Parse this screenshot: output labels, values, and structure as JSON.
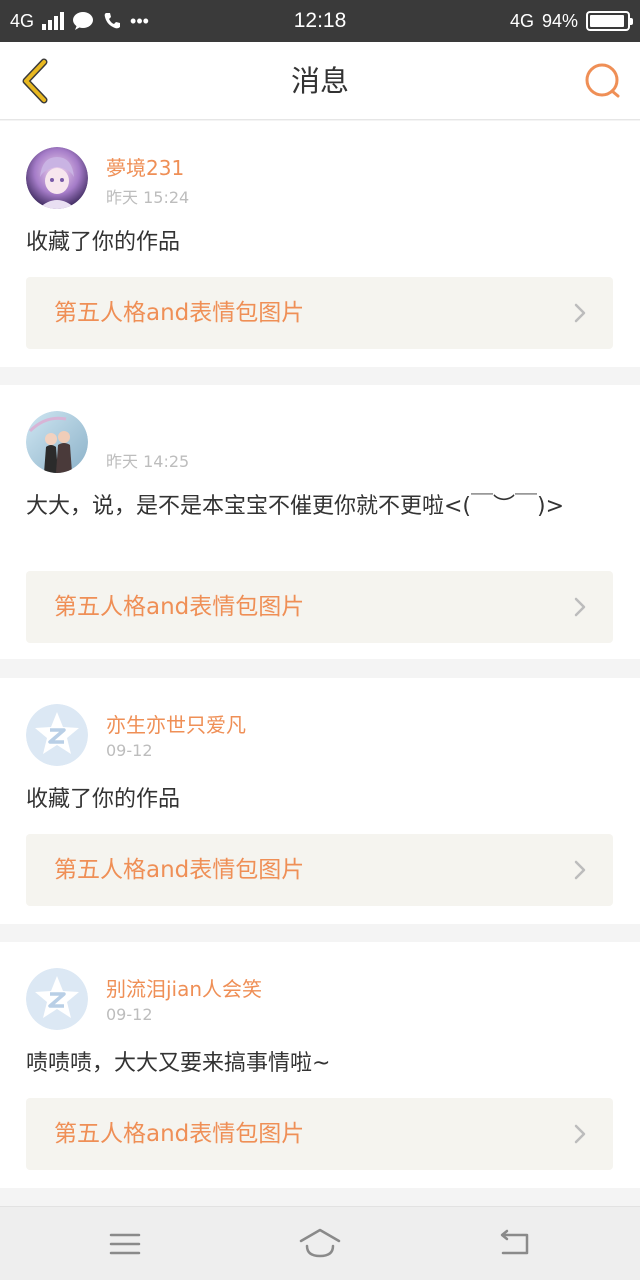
{
  "status_bar": {
    "network": "4G",
    "time": "12:18",
    "data_type": "4G",
    "battery": "94%",
    "battery_level": 0.94,
    "more": "•••"
  },
  "nav": {
    "title": "消息"
  },
  "messages": [
    {
      "username": "夢境231",
      "time": "昨天 15:24",
      "text": "收藏了你的作品",
      "work_title": "第五人格and表情包图片",
      "avatar": "anime-avatar"
    },
    {
      "username": "",
      "time": "昨天 14:25",
      "text": "大大，说，是不是本宝宝不催更你就不更啦<(￣︶￣)>",
      "work_title": "第五人格and表情包图片",
      "avatar": "photo-avatar"
    },
    {
      "username": "亦生亦世只爱凡",
      "time": "09-12",
      "text": "收藏了你的作品",
      "work_title": "第五人格and表情包图片",
      "avatar": "default-avatar"
    },
    {
      "username": "别流泪jian人会笑",
      "time": "09-12",
      "text": "啧啧啧，大大又要来搞事情啦~",
      "work_title": "第五人格and表情包图片",
      "avatar": "default-avatar"
    }
  ],
  "colors": {
    "accent": "#ef8f56",
    "back_icon": "#e8b820",
    "link_bg": "#f5f4ef",
    "status_bar": "#3a3a3a"
  }
}
